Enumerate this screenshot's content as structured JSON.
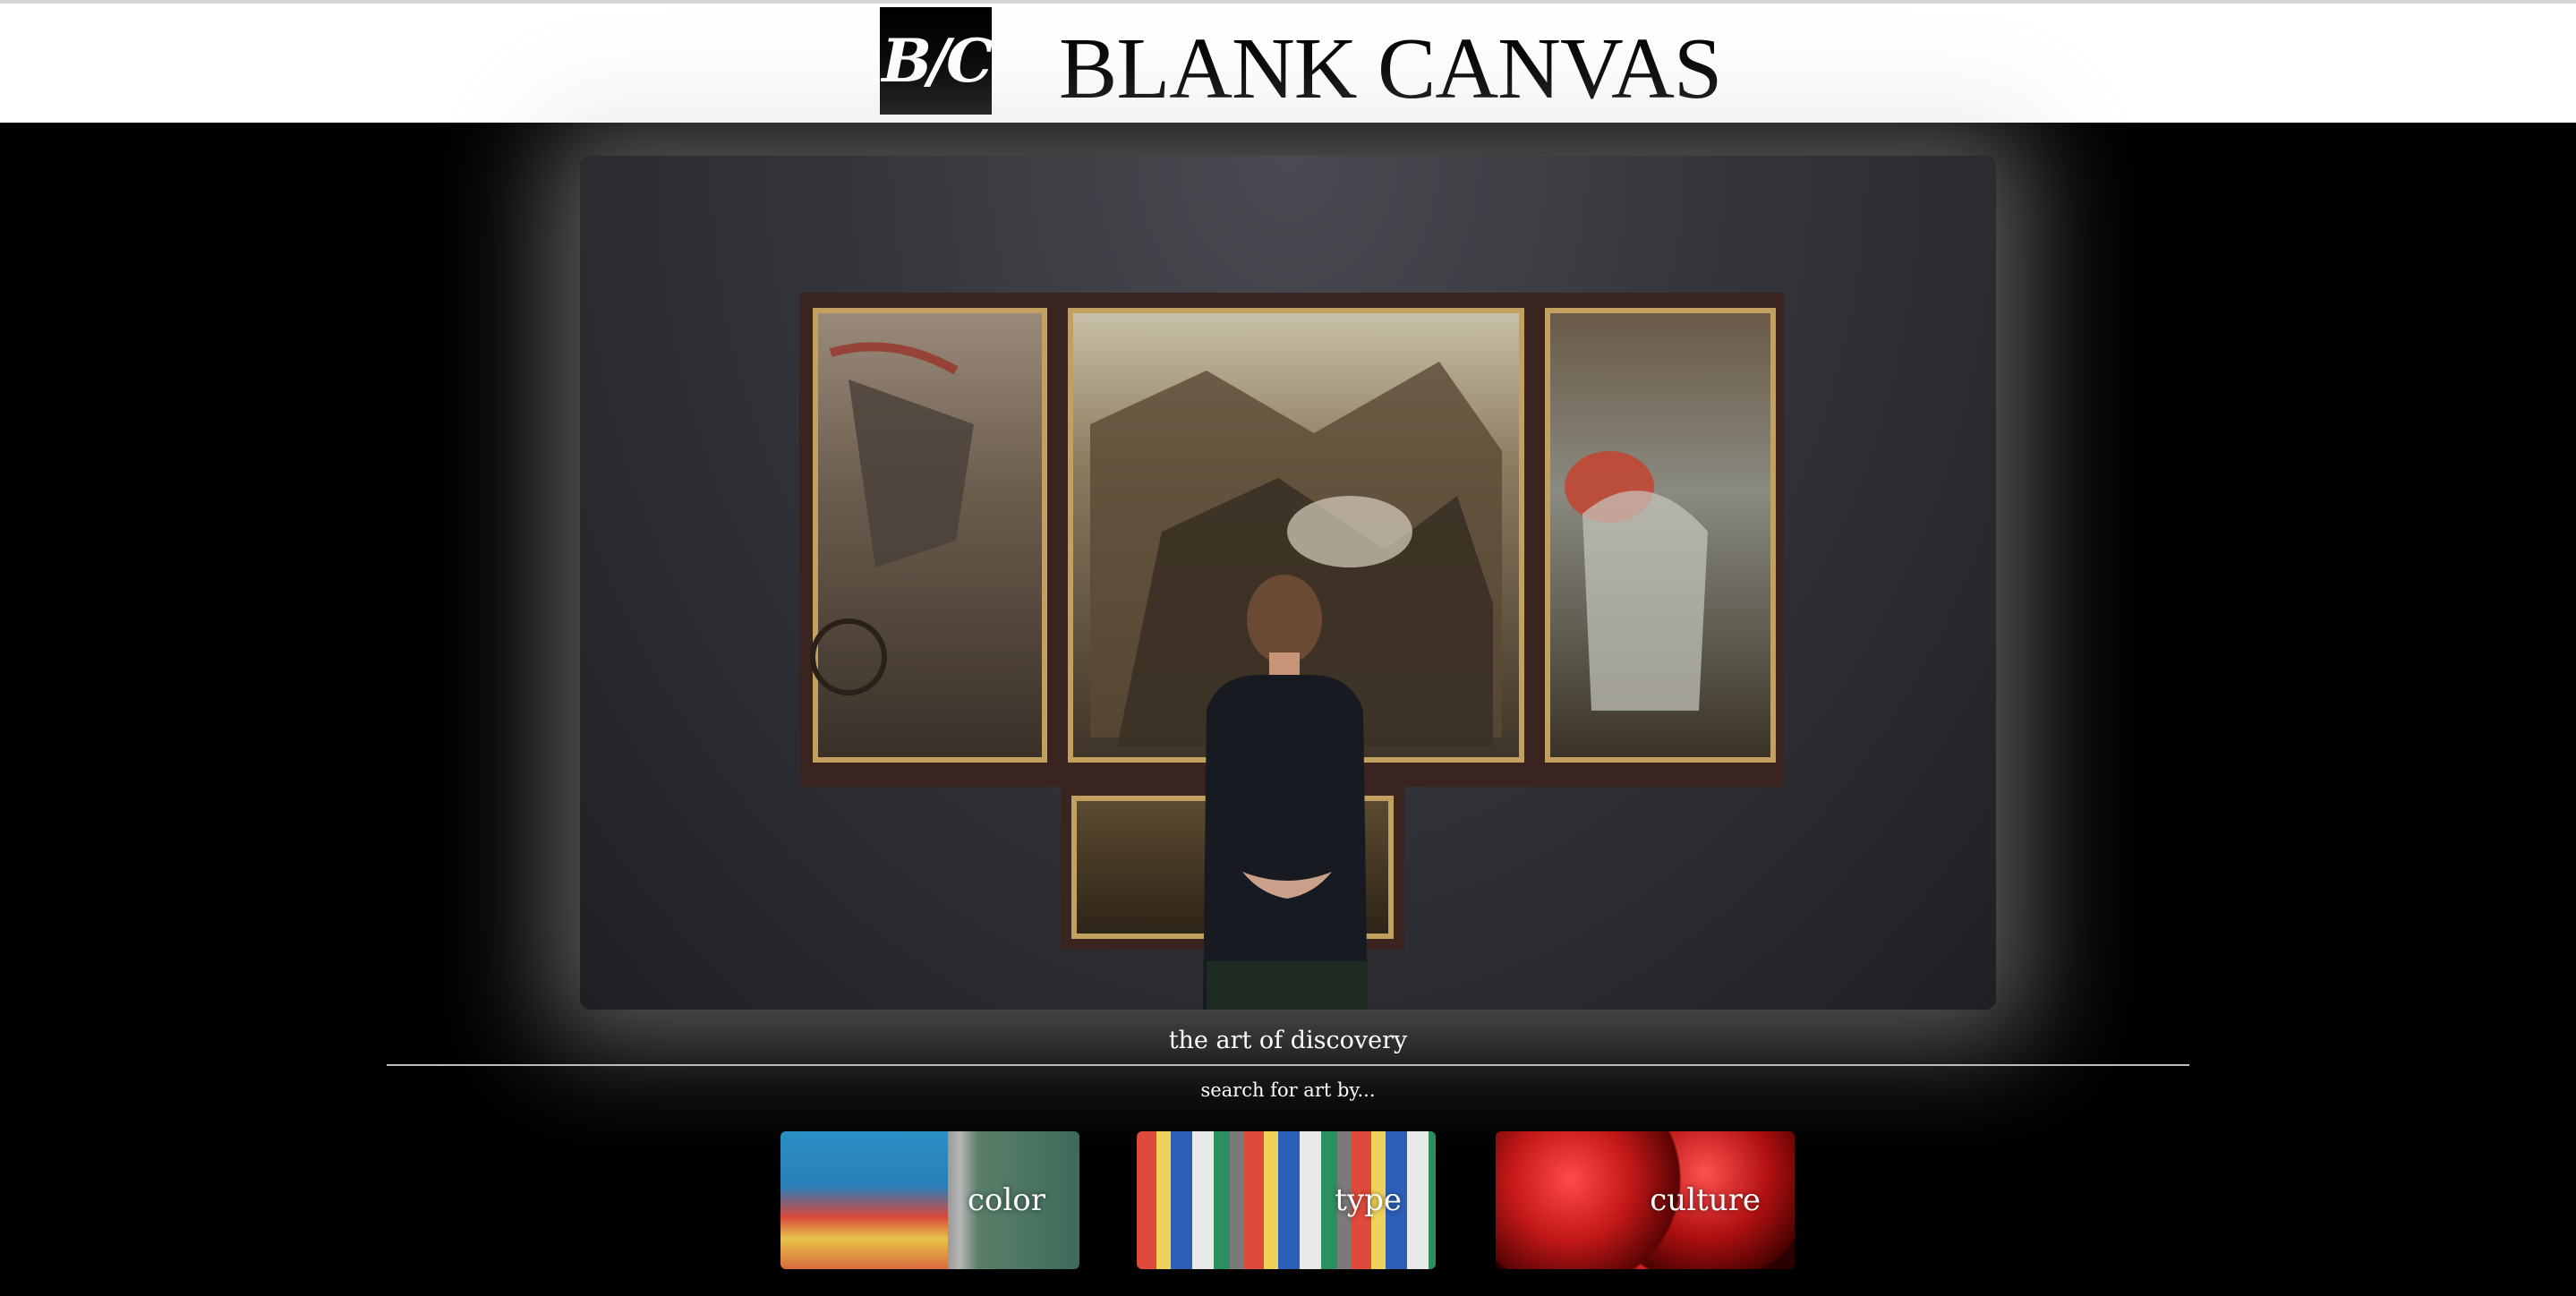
{
  "header": {
    "logo_text": "B/C",
    "site_title": "BLANK CANVAS"
  },
  "hero": {
    "image": "man viewing triptych painting in gallery"
  },
  "tagline": "the art of discovery",
  "search_prompt": "search for art by...",
  "categories": [
    {
      "label": "color"
    },
    {
      "label": "type"
    },
    {
      "label": "culture"
    }
  ],
  "colors": {
    "page_background": "#000000",
    "header_background": "#ffffff",
    "text": "#ffffff"
  }
}
